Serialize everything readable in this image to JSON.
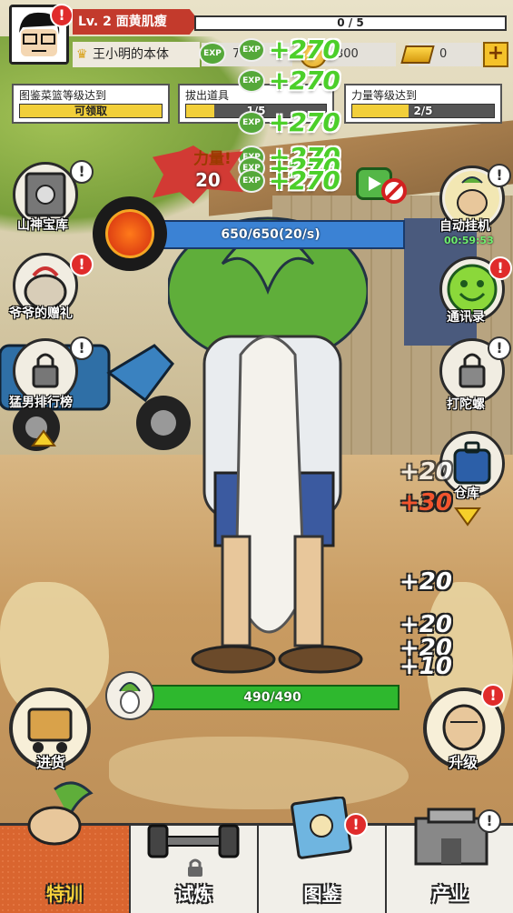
{
  "header": {
    "level_label": "Lv. 2 面黄肌瘦",
    "xp_progress": "0 / 5",
    "player_name": "王小明的本体",
    "exp_amount": "7.",
    "coins": "300",
    "gold": "0",
    "plus": "+"
  },
  "tasks": [
    {
      "title": "图鉴菜篮等级达到",
      "status": "可领取",
      "fill": 1.0
    },
    {
      "title": "拔出道具",
      "status": "1/5",
      "fill": 0.2
    },
    {
      "title": "力量等级达到",
      "status": "2/5",
      "fill": 0.4
    }
  ],
  "exp_popups": [
    "+270",
    "+270",
    "+270",
    "+270",
    "+270",
    "+270"
  ],
  "exp_icon_text": "EXP",
  "power": {
    "label": "力量!",
    "value": "20"
  },
  "boss_hp": "650/650(20/s)",
  "stamina": "490/490",
  "side_left": [
    {
      "label": "山神宝库"
    },
    {
      "label": "爷爷的赠礼"
    },
    {
      "label": "猛男排行榜"
    }
  ],
  "side_right": [
    {
      "label": "自动挂机",
      "timer": "00:59:53"
    },
    {
      "label": "通讯录"
    },
    {
      "label": "打陀螺"
    },
    {
      "label": "仓库"
    }
  ],
  "floating_numbers": [
    {
      "text": "+20",
      "color": "white"
    },
    {
      "text": "+30",
      "color": "red"
    },
    {
      "text": "+20",
      "color": "white"
    },
    {
      "text": "+20",
      "color": "white"
    },
    {
      "text": "+20",
      "color": "white"
    },
    {
      "text": "+10",
      "color": "white"
    }
  ],
  "buttons": {
    "restock": "进货",
    "upgrade": "升级"
  },
  "nav": [
    {
      "label": "特训",
      "active": true
    },
    {
      "label": "试炼",
      "active": false
    },
    {
      "label": "图鉴",
      "active": false
    },
    {
      "label": "产业",
      "active": false
    }
  ],
  "alert_mark": "!",
  "colors": {
    "exp_green": "#4ccf2a",
    "hp_blue": "#3b82d4",
    "stamina_green": "#2eb82e",
    "alert_red": "#e02b2b",
    "active_tab": "#d9652f"
  }
}
